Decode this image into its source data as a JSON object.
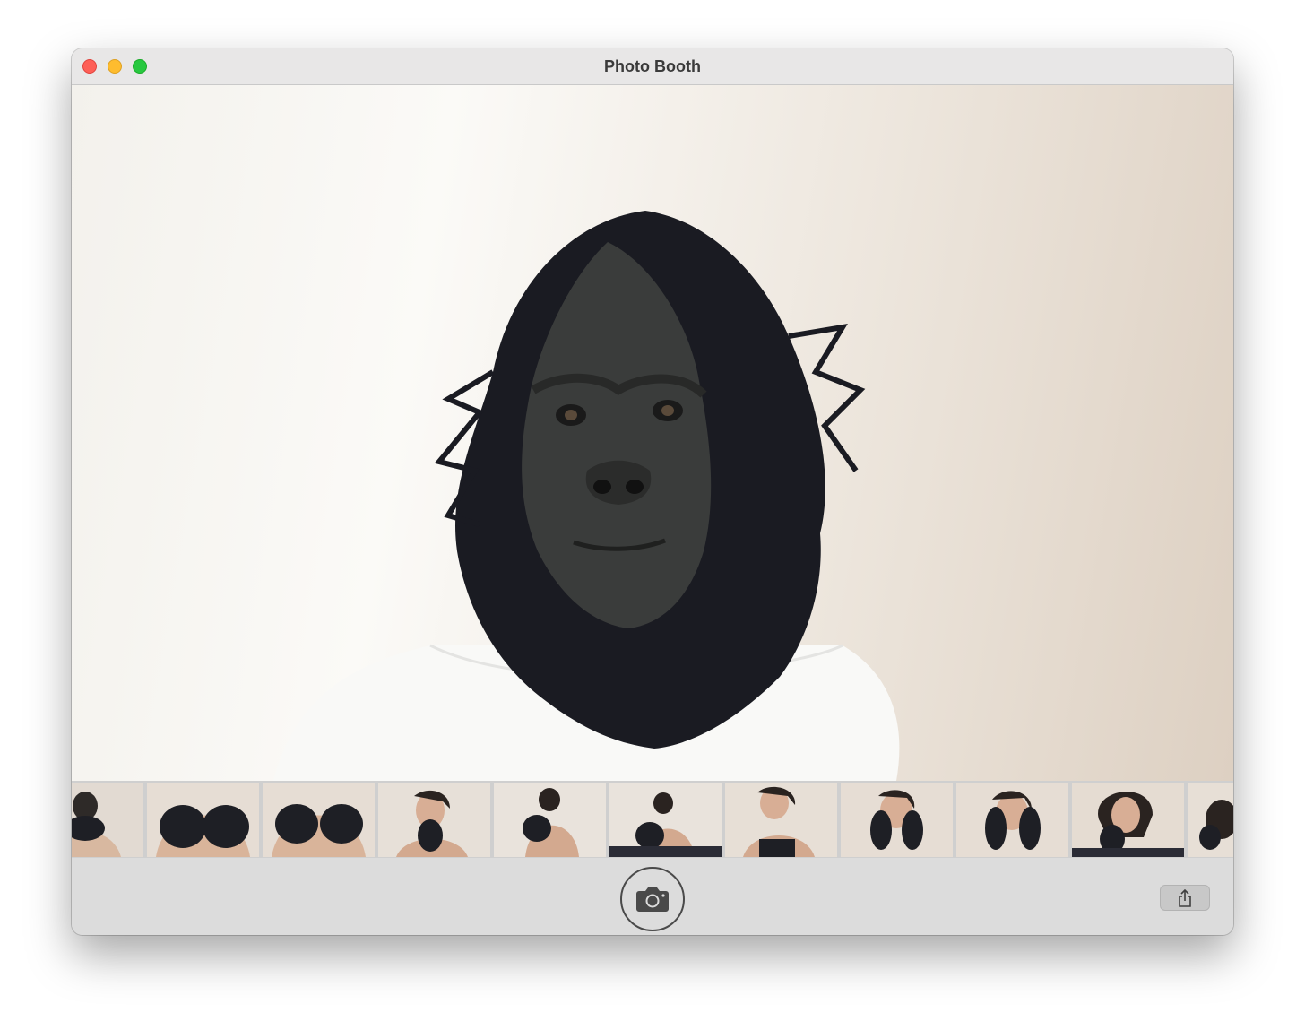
{
  "window": {
    "title": "Photo Booth"
  },
  "traffic_lights": {
    "close": "#fe5f57",
    "minimize": "#febc2e",
    "zoom": "#28c840"
  },
  "controls": {
    "shutter_icon": "camera-icon",
    "share_icon": "share-icon"
  },
  "filmstrip": {
    "thumbnail_count": 11
  }
}
